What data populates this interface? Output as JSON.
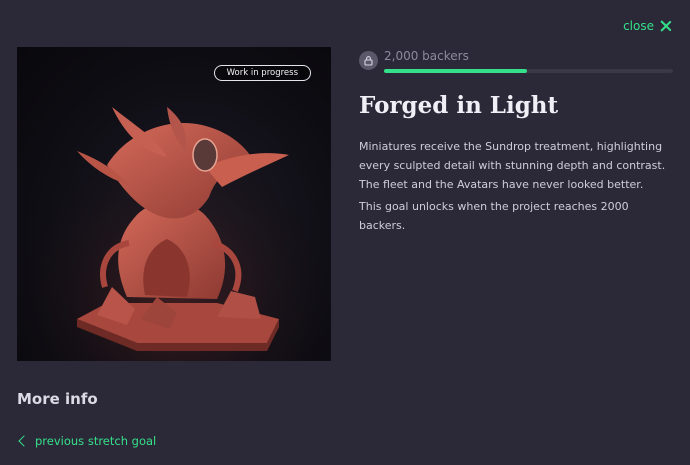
{
  "close": {
    "label": "close",
    "icon": "close-icon"
  },
  "artwork": {
    "badge": "Work in progress",
    "alt": "Sculpted miniature"
  },
  "progress": {
    "backers_text": "2,000 backers",
    "fill_fraction": 0.495,
    "lock_icon": "lock-icon"
  },
  "goal": {
    "title": "Forged in Light",
    "description": "Miniatures receive the Sundrop treatment, highlighting every sculpted detail with stunning depth and contrast. The fleet and the Avatars have never looked better.",
    "unlock_text": "This goal unlocks when the project reaches 2000 backers."
  },
  "more_info": {
    "heading": "More info"
  },
  "nav": {
    "previous_label": "previous stretch goal",
    "icon": "chevron-left-icon"
  },
  "colors": {
    "background": "#2b2938",
    "accent": "#35e08a",
    "track": "#3a3847",
    "sculpt": "#c0574a"
  }
}
